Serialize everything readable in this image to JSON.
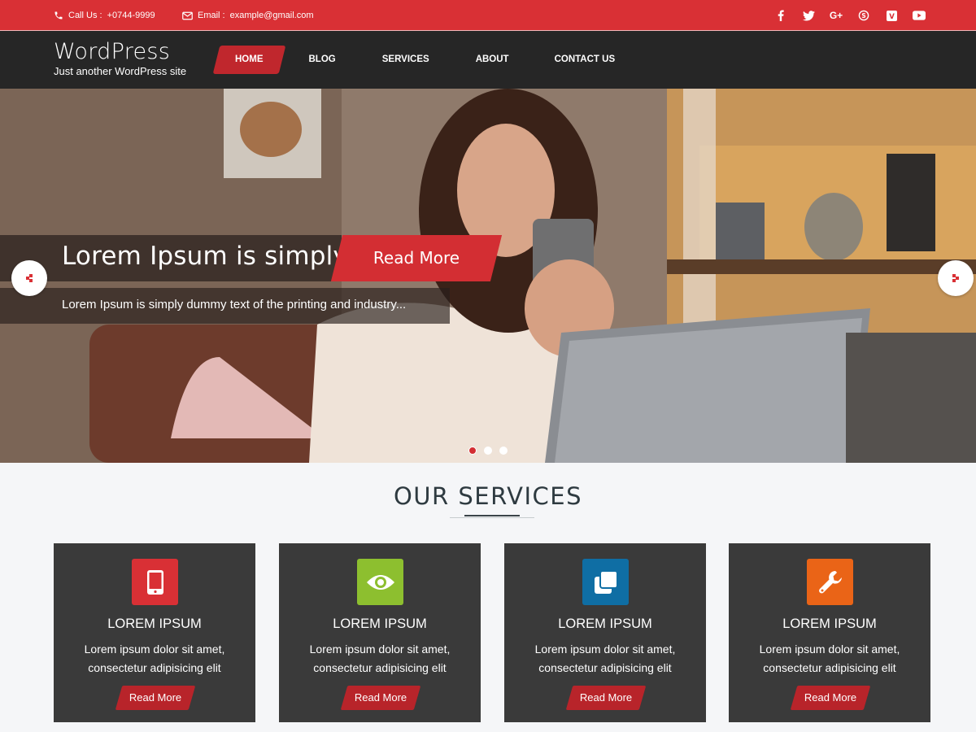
{
  "topbar": {
    "phone_label": "Call Us :",
    "phone_number": "+0744-9999",
    "email_label": "Email :",
    "email_address": "example@gmail.com",
    "social": [
      {
        "icon": "facebook-icon",
        "glyph": "f"
      },
      {
        "icon": "twitter-icon",
        "glyph": "t"
      },
      {
        "icon": "google-plus-icon",
        "glyph": "G+"
      },
      {
        "icon": "skype-icon",
        "glyph": "S"
      },
      {
        "icon": "vimeo-icon",
        "glyph": "V"
      },
      {
        "icon": "youtube-icon",
        "glyph": "▶"
      }
    ]
  },
  "brand": {
    "title": "WordPress",
    "tagline": "Just another WordPress site"
  },
  "menu": {
    "home": "HOME",
    "blog": "BLOG",
    "services": "SERVICES",
    "about": "ABOUT",
    "contact": "CONTACT US"
  },
  "hero": {
    "title": "Lorem Ipsum is simply",
    "read_more": "Read More",
    "text": "Lorem Ipsum is simply dummy text of the printing and industry...",
    "slides_total": 3,
    "active_slide": 1
  },
  "services": {
    "heading": "OUR SERVICES",
    "cards": [
      {
        "title": "LOREM IPSUM",
        "line1": "Lorem ipsum dolor sit amet,",
        "line2": "consectetur adipisicing elit",
        "button": "Read More",
        "icon": "mobile-icon",
        "color": "#d93035"
      },
      {
        "title": "LOREM IPSUM",
        "line1": "Lorem ipsum dolor sit amet,",
        "line2": "consectetur adipisicing elit",
        "button": "Read More",
        "icon": "eye-icon",
        "color": "#8dbf2f"
      },
      {
        "title": "LOREM IPSUM",
        "line1": "Lorem ipsum dolor sit amet,",
        "line2": "consectetur adipisicing elit",
        "button": "Read More",
        "icon": "clone-icon",
        "color": "#0f6ea4"
      },
      {
        "title": "LOREM IPSUM",
        "line1": "Lorem ipsum dolor sit amet,",
        "line2": "consectetur adipisicing elit",
        "button": "Read More",
        "icon": "wrench-icon",
        "color": "#ea6417"
      }
    ]
  },
  "colors": {
    "accent": "#d93035",
    "nav_bg": "#262626",
    "card_bg": "#3a3a3a"
  }
}
